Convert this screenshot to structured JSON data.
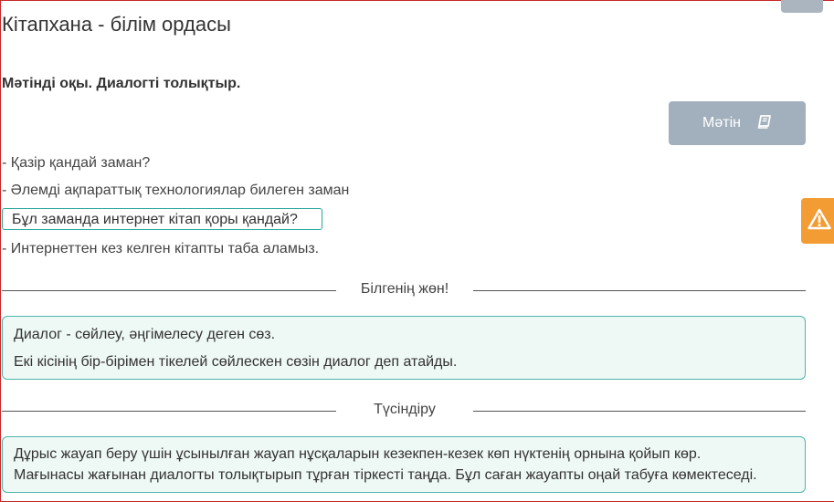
{
  "page": {
    "title": "Кітапхана - білім ордасы",
    "instruction": "Мәтінді оқы. Диалогті толықтыр."
  },
  "toolbar": {
    "text_button_label": "Мәтін",
    "text_button_icon": "book-icon",
    "warning_icon": "warning-icon",
    "warning_color": "#f39c34",
    "button_color": "#a2b0bd"
  },
  "dialogue": {
    "lines": [
      "- Қазір қандай заман?",
      "- Әлемді ақпараттық технологиялар билеген заман",
      "- Интернеттен кез келген кітапты таба аламыз."
    ],
    "selected_answer": "Бұл заманда интернет кітап қоры қандай?"
  },
  "sections": {
    "know": {
      "heading": "Білгенің жөн!",
      "lines": [
        "Диалог - сөйлеу, әңгімелесу деген сөз.",
        "Екі кісінің бір-бірімен тікелей сөйлескен сөзін диалог деп атайды."
      ]
    },
    "explain": {
      "heading": "Түсіндіру",
      "lines": [
        "Дұрыс жауап беру үшін ұсынылған жауап нұсқаларын кезекпен-кезек көп нүктенің орнына қойып көр.",
        "Мағынасы жағынан диалогты толықтырып тұрған тіркесті таңда. Бұл саған жауапты оңай табуға көмектеседі."
      ]
    }
  }
}
